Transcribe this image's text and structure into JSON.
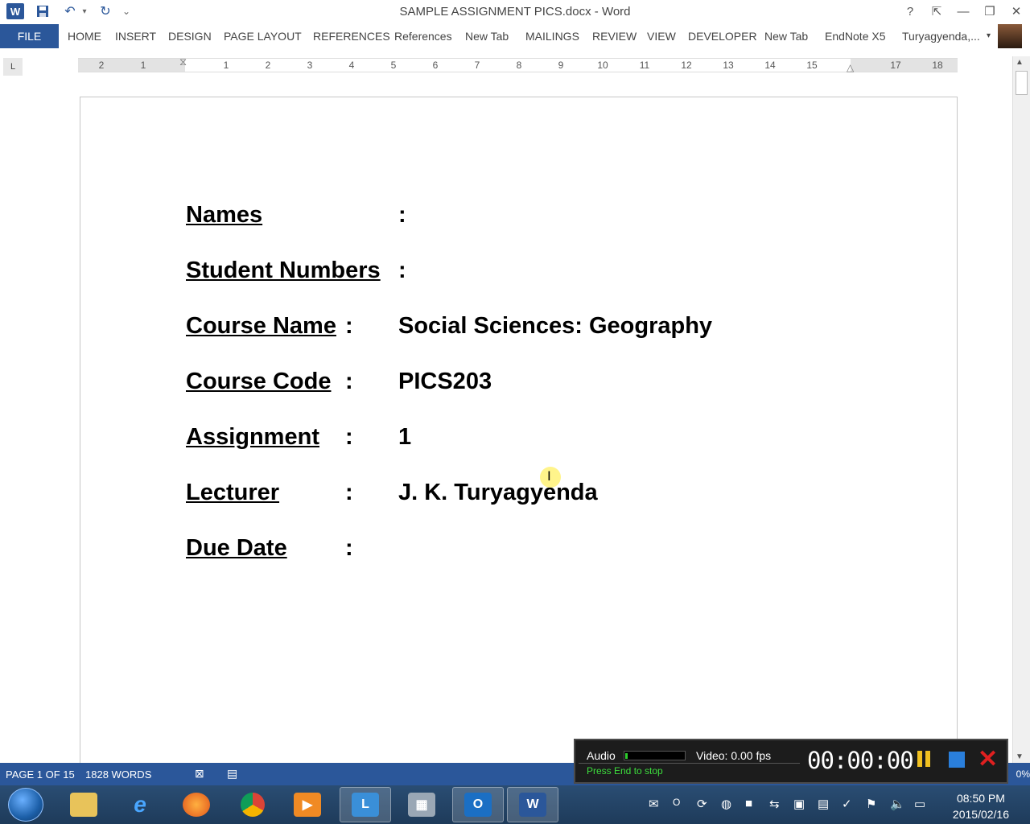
{
  "window": {
    "title": "SAMPLE ASSIGNMENT PICS.docx - Word",
    "app_icon": "W",
    "help": "?",
    "ribbon_display": "⇱",
    "minimize": "—",
    "restore": "❐",
    "close": "✕"
  },
  "quick_access": {
    "save_icon": "save-icon",
    "undo": "↶",
    "redo": "↻",
    "customize": "⌄"
  },
  "ribbon": {
    "file": "FILE",
    "tabs": [
      "HOME",
      "INSERT",
      "DESIGN",
      "PAGE LAYOUT",
      "REFERENCES",
      "References",
      "New Tab",
      "MAILINGS",
      "REVIEW",
      "VIEW",
      "DEVELOPER",
      "New Tab",
      "EndNote X5",
      "Turyagyenda,..."
    ]
  },
  "ruler": {
    "tab_selector": "L",
    "numbers": [
      "2",
      "1",
      "1",
      "2",
      "3",
      "4",
      "5",
      "6",
      "7",
      "8",
      "9",
      "10",
      "11",
      "12",
      "13",
      "14",
      "15",
      "17",
      "18"
    ]
  },
  "document": {
    "rows": [
      {
        "label": "Names",
        "colon": ":",
        "value": ""
      },
      {
        "label": "Student Numbers",
        "colon": ":",
        "value": ""
      },
      {
        "label": "Course Name",
        "colon": ":",
        "value": "Social Sciences: Geography"
      },
      {
        "label": "Course Code",
        "colon": ":",
        "value": "PICS203"
      },
      {
        "label": "Assignment",
        "colon": ":",
        "value": "1"
      },
      {
        "label": "Lecturer",
        "colon": ":",
        "value": "J. K. Turyagyenda"
      },
      {
        "label": "Due Date",
        "colon": ":",
        "value": ""
      }
    ]
  },
  "statusbar": {
    "page": "PAGE 1 OF 15",
    "words": "1828 WORDS",
    "zoom": "0%"
  },
  "recorder": {
    "audio": "Audio",
    "video": "Video: 0.00 fps",
    "hint": "Press End to stop",
    "timer": "00:00:00"
  },
  "taskbar": {
    "clock_time": "08:50 PM",
    "clock_date": "2015/02/16"
  },
  "colors": {
    "accent": "#2b579a",
    "recorder_hint": "#3dde3d"
  }
}
